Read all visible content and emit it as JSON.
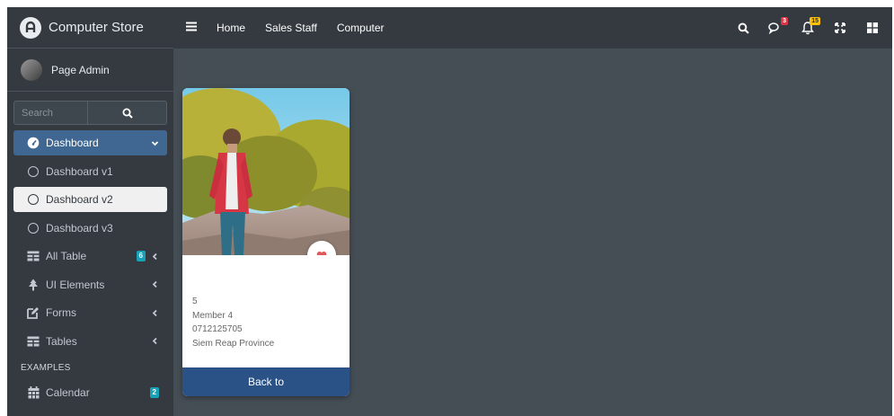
{
  "brand": {
    "name": "Computer Store"
  },
  "user": {
    "name": "Page Admin"
  },
  "search": {
    "placeholder": "Search"
  },
  "sidebar": {
    "items": [
      {
        "label": "Dashboard",
        "icon": "tachometer-icon"
      },
      {
        "label": "Dashboard v1",
        "icon": "circle-icon"
      },
      {
        "label": "Dashboard v2",
        "icon": "circle-icon"
      },
      {
        "label": "Dashboard v3",
        "icon": "circle-icon"
      },
      {
        "label": "All Table",
        "icon": "table-icon",
        "badge": "6"
      },
      {
        "label": "UI Elements",
        "icon": "tree-icon"
      },
      {
        "label": "Forms",
        "icon": "edit-icon"
      },
      {
        "label": "Tables",
        "icon": "table-icon"
      }
    ],
    "section_header": "EXAMPLES",
    "calendar": {
      "label": "Calendar",
      "icon": "calendar-icon",
      "badge": "2"
    }
  },
  "topbar": {
    "links": [
      "Home",
      "Sales Staff",
      "Computer"
    ],
    "messages_count": "3",
    "notifications_count": "15"
  },
  "card": {
    "id": "5",
    "name": "Member 4",
    "phone": "0712125705",
    "location": "Siem Reap Province",
    "button_label": "Back to"
  },
  "colors": {
    "sidebar_bg": "#343a40",
    "content_bg": "#454d55",
    "active_item": "#3f6791",
    "badge_info": "#17a2b8",
    "button": "#2a5286",
    "heart": "#e05a5a"
  }
}
